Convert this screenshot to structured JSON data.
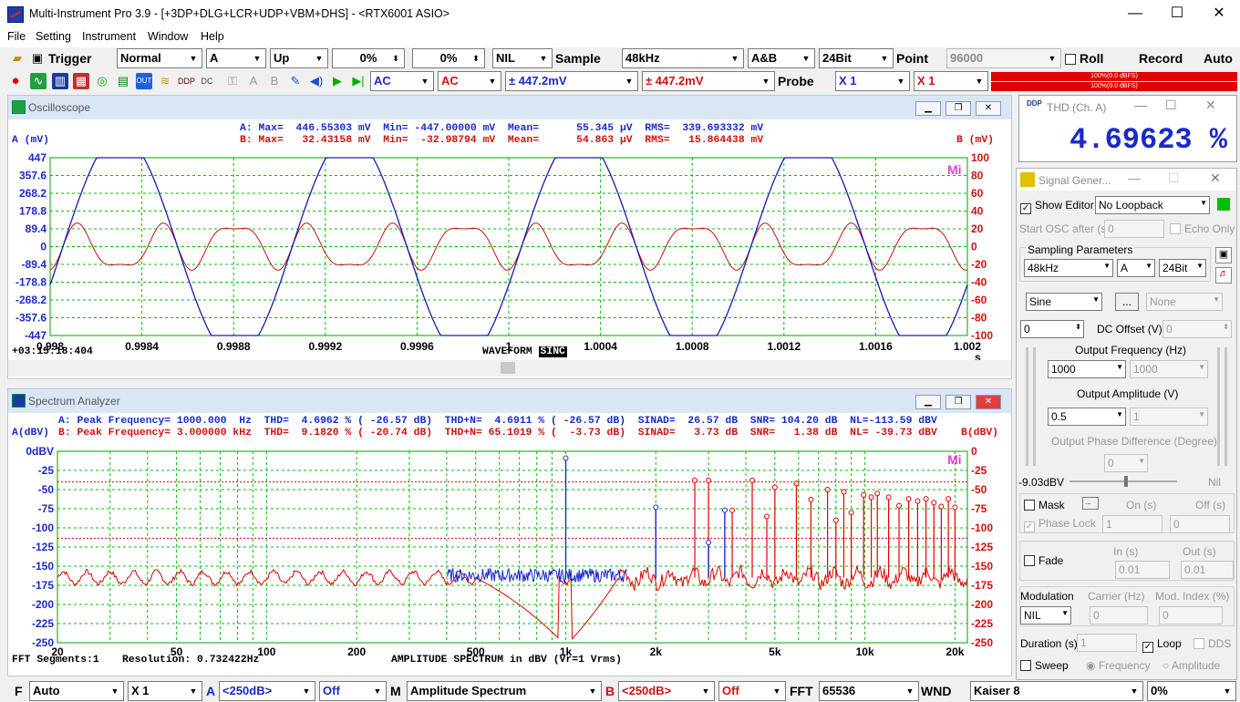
{
  "window": {
    "title": "Multi-Instrument Pro 3.9    -    [+3DP+DLG+LCR+UDP+VBM+DHS]    -    <RTX6001 ASIO>",
    "min": "—",
    "max": "☐",
    "close": "✕"
  },
  "menu": [
    "File",
    "Setting",
    "Instrument",
    "Window",
    "Help"
  ],
  "toolbar1": {
    "trigger_label": "Trigger",
    "mode": "Normal",
    "channel": "A",
    "edge": "Up",
    "level1": "0%",
    "level2": "0%",
    "filter": "NIL",
    "sample_label": "Sample",
    "sample_rate": "48kHz",
    "channels": "A&B",
    "bit_depth": "24Bit",
    "point_label": "Point",
    "points": "96000",
    "roll_label": "Roll",
    "record_label": "Record",
    "auto_label": "Auto"
  },
  "toolbar2": {
    "coupling_a": "AC",
    "coupling_b": "AC",
    "range_a": "± 447.2mV",
    "range_b": "± 447.2mV",
    "probe_label": "Probe",
    "probe_a": "X 1",
    "probe_b": "X 1",
    "meter_a": "100%(0.0 dBFS)",
    "meter_b": "100%(0.0 dBFS)"
  },
  "oscilloscope": {
    "title": "Oscilloscope",
    "stats_a": "A: Max=  446.55303 mV  Min= -447.00000 mV  Mean=      55.345 µV  RMS=  339.693332 mV",
    "stats_b": "B: Max=   32.43158 mV  Min=  -32.98794 mV  Mean=      54.863 µV  RMS=   15.864438 mV",
    "ylabel_a": "A (mV)",
    "ylabel_b": "B (mV)",
    "yticks_a": [
      "447",
      "357.6",
      "268.2",
      "178.8",
      "89.4",
      "0",
      "-89.4",
      "-178.8",
      "-268.2",
      "-357.6",
      "-447"
    ],
    "yticks_b": [
      "100",
      "80",
      "60",
      "40",
      "20",
      "0",
      "-20",
      "-40",
      "-60",
      "-80",
      "-100"
    ],
    "xticks": [
      "0.998",
      "0.9984",
      "0.9988",
      "0.9992",
      "0.9996",
      "1",
      "1.0004",
      "1.0008",
      "1.0012",
      "1.0016",
      "1.002"
    ],
    "xunit": "s",
    "timestamp": "+03:15:18:404",
    "caption": "WAVEFORM",
    "caption2": "SINC",
    "logo": "Mi"
  },
  "spectrum": {
    "title": "Spectrum Analyzer",
    "stats_a": "A: Peak Frequency= 1000.000  Hz  THD=  4.6962 % ( -26.57 dB)  THD+N=  4.6911 % ( -26.57 dB)  SINAD=  26.57 dB  SNR= 104.20 dB  NL=-113.59 dBV",
    "stats_b": "B: Peak Frequency= 3.000000 kHz  THD=  9.1820 % ( -20.74 dB)  THD+N= 65.1019 % (  -3.73 dB)  SINAD=   3.73 dB  SNR=   1.38 dB  NL= -39.73 dBV",
    "ylabel_a": "A(dBV)",
    "ylabel_b": "B(dBV)",
    "yticks_a": [
      "0dBV",
      "-25",
      "-50",
      "-75",
      "-100",
      "-125",
      "-150",
      "-175",
      "-200",
      "-225",
      "-250"
    ],
    "yticks_b": [
      "0",
      "-25",
      "-50",
      "-75",
      "-100",
      "-125",
      "-150",
      "-175",
      "-200",
      "-225",
      "-250"
    ],
    "xticks": [
      "20",
      "50",
      "100",
      "200",
      "500",
      "1k",
      "2k",
      "5k",
      "10k",
      "20k"
    ],
    "xunit": "Hz",
    "segments": "FFT Segments:1",
    "resolution": "Resolution: 0.732422Hz",
    "caption": "AMPLITUDE SPECTRUM in dBV (Vr=1 Vrms)",
    "logo": "Mi"
  },
  "thd_meter": {
    "title": "THD (Ch. A)",
    "value": "4.69623 %"
  },
  "signal_gen": {
    "title": "Signal Gener...",
    "show_editor": "Show Editor",
    "loopback": "No Loopback",
    "start_osc": "Start OSC after (s)",
    "start_osc_val": "0",
    "echo_only": "Echo Only",
    "sampling_params": "Sampling Parameters",
    "sg_rate": "48kHz",
    "sg_ch": "A",
    "sg_bits": "24Bit",
    "waveform": "Sine",
    "more": "...",
    "waveform2": "None",
    "dc_val": "0",
    "dc_offset": "DC Offset (V)",
    "dc_val2": "0",
    "out_freq": "Output Frequency (Hz)",
    "freq": "1000",
    "freq2": "1000",
    "out_amp": "Output Amplitude (V)",
    "amp": "0.5",
    "amp2": "1",
    "phase": "Output Phase Difference (Degree)",
    "phase_val": "0",
    "level": "-9.03dBV",
    "nil": "Nil",
    "mask": "Mask",
    "mask_btn": "...",
    "on": "On (s)",
    "off": "Off (s)",
    "phase_lock": "Phase Lock",
    "pl_on": "1",
    "pl_off": "0",
    "fade": "Fade",
    "in": "In (s)",
    "out": "Out (s)",
    "fade_in": "0.01",
    "fade_out": "0.01",
    "modulation": "Modulation",
    "carrier": "Carrier (Hz)",
    "mod_index": "Mod. Index (%)",
    "mod_type": "NIL",
    "carrier_val": "0",
    "mod_val": "0",
    "duration": "Duration (s)",
    "duration_val": "1",
    "loop": "Loop",
    "dds": "DDS",
    "sweep": "Sweep",
    "frequency": "Frequency",
    "amplitude": "Amplitude"
  },
  "bottombar": {
    "f_label": "F",
    "f_mode": "Auto",
    "f_mult": "X 1",
    "a_label": "A",
    "a_floor": "<250dB>",
    "a_off": "Off",
    "m_label": "M",
    "m_mode": "Amplitude Spectrum",
    "b_label": "B",
    "b_floor": "<250dB>",
    "b_off": "Off",
    "fft_label": "FFT",
    "fft_size": "65536",
    "wnd_label": "WND",
    "window": "Kaiser 8",
    "overlap": "0%"
  },
  "chart_data": [
    {
      "type": "line",
      "title": "Oscilloscope",
      "x_range": [
        0.998,
        1.002
      ],
      "xlabel": "s",
      "ylim_a": [
        -447,
        447
      ],
      "ylim_b": [
        -100,
        100
      ],
      "series": [
        {
          "name": "A",
          "description_values": "clipped sine 1000 Hz, amplitude ±447 mV, 4 cycles"
        },
        {
          "name": "B",
          "description_values": "distortion residual, ±32 mV"
        }
      ]
    },
    {
      "type": "line",
      "title": "Spectrum Analyzer",
      "x_range": [
        20,
        22000
      ],
      "x_scale": "log",
      "ylim": [
        -250,
        0
      ],
      "series": [
        {
          "name": "A",
          "peaks": [
            [
              1000,
              -9
            ],
            [
              2000,
              -73
            ],
            [
              3000,
              -119
            ],
            [
              3400,
              -77
            ]
          ]
        },
        {
          "name": "B",
          "peaks": [
            [
              2700,
              -38
            ],
            [
              3000,
              -38
            ],
            [
              3600,
              -77
            ],
            [
              4200,
              -38
            ],
            [
              4700,
              -85
            ],
            [
              5000,
              -47
            ],
            [
              5900,
              -42
            ],
            [
              6600,
              -63
            ],
            [
              7500,
              -50
            ],
            [
              8000,
              -90
            ],
            [
              8500,
              -53
            ],
            [
              9000,
              -80
            ],
            [
              9900,
              -57
            ],
            [
              10500,
              -60
            ],
            [
              11000,
              -55
            ],
            [
              12000,
              -60
            ],
            [
              13000,
              -71
            ],
            [
              14000,
              -62
            ],
            [
              15000,
              -65
            ],
            [
              16000,
              -62
            ],
            [
              17000,
              -67
            ],
            [
              18000,
              -72
            ],
            [
              19000,
              -62
            ],
            [
              20000,
              -73
            ]
          ]
        }
      ]
    }
  ]
}
